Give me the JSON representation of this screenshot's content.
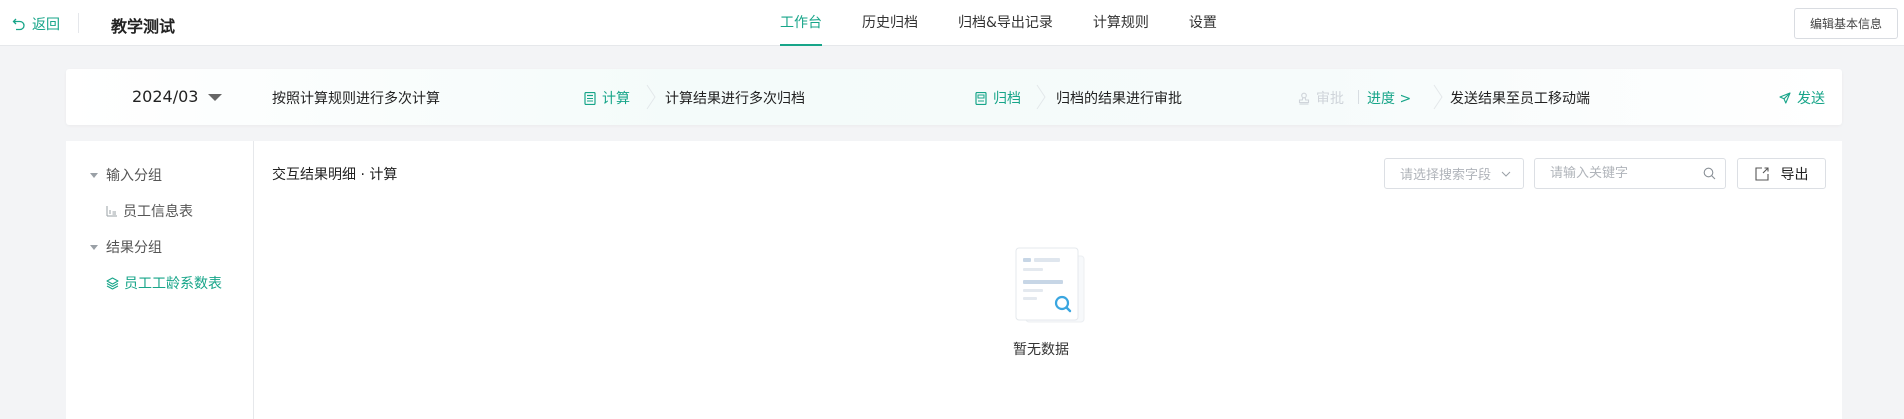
{
  "header": {
    "back_label": "返回",
    "back_icon": "undo-icon",
    "app_title": "教学测试",
    "tabs": [
      {
        "label": "工作台",
        "active": true
      },
      {
        "label": "历史归档",
        "active": false
      },
      {
        "label": "归档&导出记录",
        "active": false
      },
      {
        "label": "计算规则",
        "active": false
      },
      {
        "label": "设置",
        "active": false
      }
    ],
    "edit_button_label": "编辑基本信息"
  },
  "steps": {
    "period": "2024/03",
    "step1_desc": "按照计算规则进行多次计算",
    "step1_action": "计算",
    "step2_desc": "计算结果进行多次归档",
    "step2_action": "归档",
    "step3_desc": "归档的结果进行审批",
    "step3_action": "审批",
    "step3_progress": "进度 >",
    "step4_desc": "发送结果至员工移动端",
    "step4_action": "发送"
  },
  "sidebar": {
    "groups": [
      {
        "label": "输入分组",
        "items": [
          {
            "label": "员工信息表",
            "active": false
          }
        ]
      },
      {
        "label": "结果分组",
        "items": [
          {
            "label": "员工工龄系数表",
            "active": true
          }
        ]
      }
    ]
  },
  "content": {
    "title": "交互结果明细 · 计算",
    "search_field_placeholder": "请选择搜索字段",
    "keyword_placeholder": "请输入关键字",
    "export_label": "导出",
    "empty_text": "暂无数据"
  },
  "colors": {
    "accent": "#17a589",
    "disabled": "#cfd4da",
    "background": "#f3f4f6"
  }
}
